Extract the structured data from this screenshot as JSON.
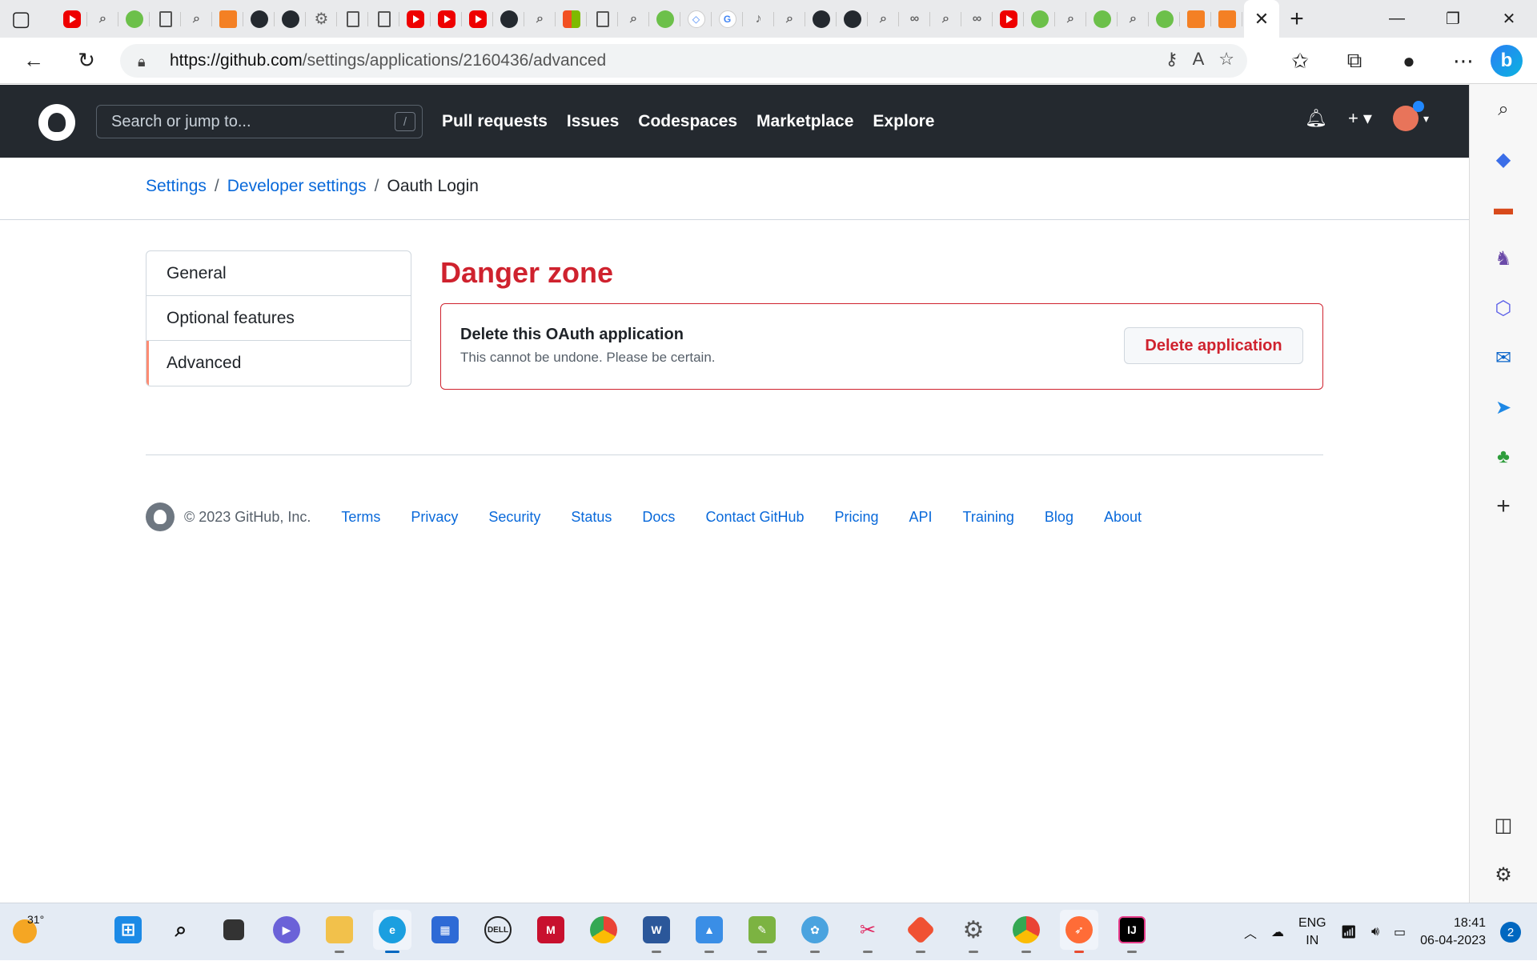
{
  "browser": {
    "url_host": "https://github.com",
    "url_path": "/settings/applications/2160436/advanced",
    "tab_favicons": [
      "youtube-icon",
      "search-icon",
      "leaf-icon",
      "document-icon",
      "search-icon",
      "stackoverflow-icon",
      "github-icon",
      "github-icon",
      "gear-icon",
      "document-icon",
      "window-icon",
      "youtube-icon",
      "youtube-icon",
      "youtube-icon",
      "github-icon",
      "search-icon",
      "microsoft-icon",
      "window-icon",
      "search-icon",
      "leaf-icon",
      "code-icon",
      "google-icon",
      "tiktok-icon",
      "search-icon",
      "github-icon",
      "github-icon",
      "search-icon",
      "link-icon",
      "search-icon",
      "link-icon",
      "youtube-icon",
      "leaf-icon",
      "search-icon",
      "leaf-icon",
      "search-icon",
      "leaf-icon",
      "stackoverflow-icon",
      "stackoverflow-icon"
    ],
    "active_tab_close": "✕",
    "new_tab": "+"
  },
  "header": {
    "search_placeholder": "Search or jump to...",
    "search_key": "/",
    "nav": [
      "Pull requests",
      "Issues",
      "Codespaces",
      "Marketplace",
      "Explore"
    ]
  },
  "breadcrumb": {
    "settings": "Settings",
    "developer_settings": "Developer settings",
    "current": "Oauth Login",
    "separator": "/"
  },
  "menu": {
    "items": [
      "General",
      "Optional features",
      "Advanced"
    ],
    "selected": "Advanced"
  },
  "danger_zone": {
    "title": "Danger zone",
    "heading": "Delete this OAuth application",
    "description": "This cannot be undone. Please be certain.",
    "button": "Delete application"
  },
  "footer": {
    "copyright": "© 2023 GitHub, Inc.",
    "links": [
      "Terms",
      "Privacy",
      "Security",
      "Status",
      "Docs",
      "Contact GitHub",
      "Pricing",
      "API",
      "Training",
      "Blog",
      "About"
    ]
  },
  "taskbar": {
    "temperature": "31°",
    "lang_line1": "ENG",
    "lang_line2": "IN",
    "time": "18:41",
    "date": "06-04-2023",
    "notifications": "2"
  },
  "colors": {
    "header_bg": "#24292f",
    "danger": "#cf222e",
    "link": "#0969da",
    "selected_marker": "#fd8c73"
  }
}
